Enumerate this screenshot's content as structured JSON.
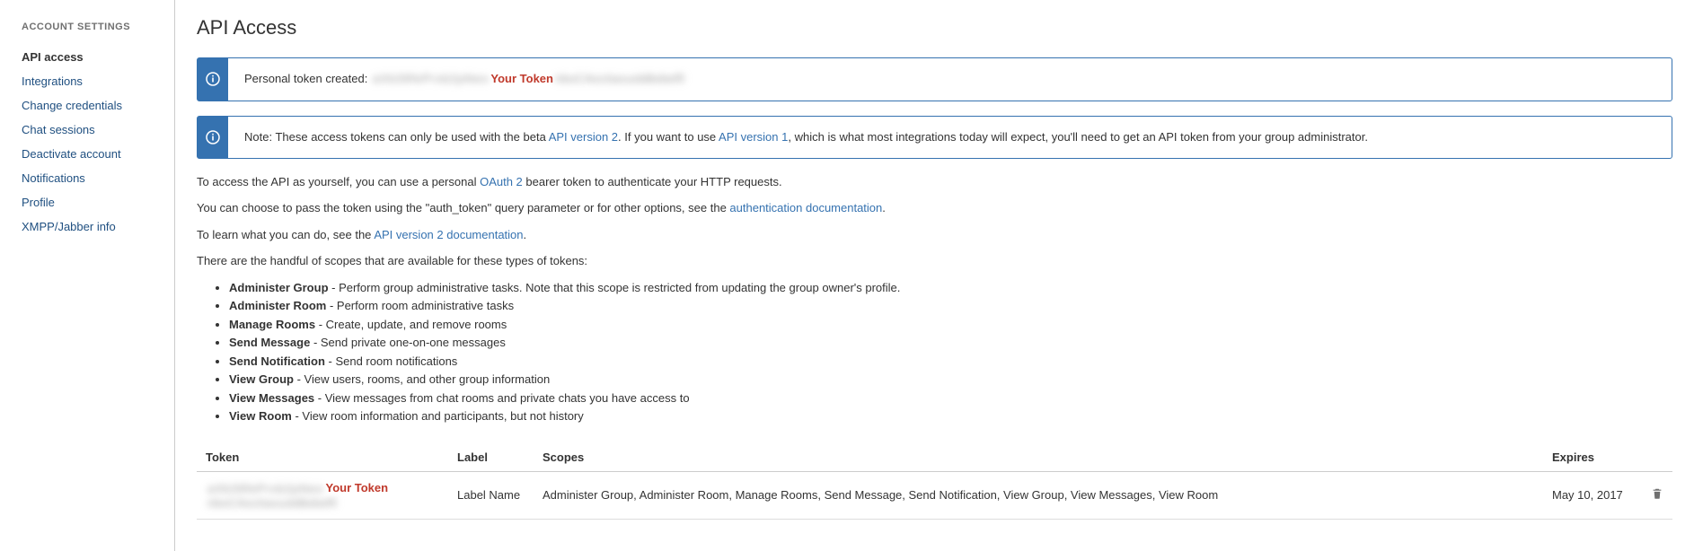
{
  "sidebar": {
    "heading": "ACCOUNT SETTINGS",
    "items": [
      {
        "label": "API access",
        "active": true
      },
      {
        "label": "Integrations"
      },
      {
        "label": "Change credentials"
      },
      {
        "label": "Chat sessions"
      },
      {
        "label": "Deactivate account"
      },
      {
        "label": "Notifications"
      },
      {
        "label": "Profile"
      },
      {
        "label": "XMPP/Jabber info"
      }
    ]
  },
  "page": {
    "title": "API Access"
  },
  "alerts": {
    "created_prefix": "Personal token created: ",
    "token_highlight": "Your Token",
    "note_pre": "Note: These access tokens can only be used with the beta ",
    "note_link1": "API version 2",
    "note_mid1": ". If you want to use ",
    "note_link2": "API version 1",
    "note_post": ", which is what most integrations today will expect, you'll need to get an API token from your group administrator."
  },
  "intro": {
    "p1_pre": "To access the API as yourself, you can use a personal ",
    "p1_link": "OAuth 2",
    "p1_post": " bearer token to authenticate your HTTP requests.",
    "p2_pre": "You can choose to pass the token using the \"auth_token\" query parameter or for other options, see the ",
    "p2_link": "authentication documentation",
    "p2_post": ".",
    "p3_pre": "To learn what you can do, see the ",
    "p3_link": "API version 2 documentation",
    "p3_post": ".",
    "p4": "There are the handful of scopes that are available for these types of tokens:"
  },
  "scopes": [
    {
      "name": "Administer Group",
      "desc": " - Perform group administrative tasks. Note that this scope is restricted from updating the group owner's profile."
    },
    {
      "name": "Administer Room",
      "desc": " - Perform room administrative tasks"
    },
    {
      "name": "Manage Rooms",
      "desc": " - Create, update, and remove rooms"
    },
    {
      "name": "Send Message",
      "desc": " - Send private one-on-one messages"
    },
    {
      "name": "Send Notification",
      "desc": " - Send room notifications"
    },
    {
      "name": "View Group",
      "desc": " - View users, rooms, and other group information"
    },
    {
      "name": "View Messages",
      "desc": " - View messages from chat rooms and private chats you have access to"
    },
    {
      "name": "View Room",
      "desc": " - View room information and participants, but not history"
    }
  ],
  "table": {
    "headers": {
      "token": "Token",
      "label": "Label",
      "scopes": "Scopes",
      "expires": "Expires"
    },
    "rows": [
      {
        "token_highlight": "Your Token",
        "label": "Label Name",
        "scopes": "Administer Group, Administer Room, Manage Rooms, Send Message, Send Notification, View Group, View Messages, View Room",
        "expires": "May 10, 2017"
      }
    ]
  }
}
